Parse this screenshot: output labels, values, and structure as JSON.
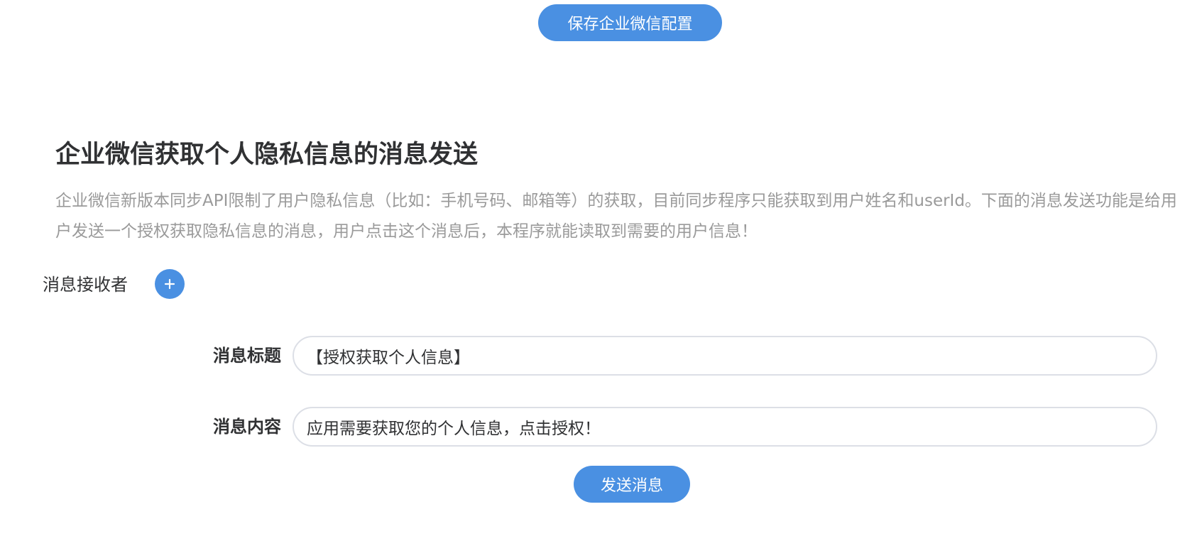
{
  "toolbar": {
    "save_label": "保存企业微信配置"
  },
  "section": {
    "title": "企业微信获取个人隐私信息的消息发送",
    "description": "企业微信新版本同步API限制了用户隐私信息（比如：手机号码、邮箱等）的获取，目前同步程序只能获取到用户姓名和userId。下面的消息发送功能是给用户发送一个授权获取隐私信息的消息，用户点击这个消息后，本程序就能读取到需要的用户信息！"
  },
  "recipients": {
    "label": "消息接收者",
    "add_icon": "plus-icon"
  },
  "form": {
    "title_label": "消息标题",
    "title_value": "【授权获取个人信息】",
    "content_label": "消息内容",
    "content_value": "应用需要获取您的个人信息，点击授权！"
  },
  "actions": {
    "send_label": "发送消息"
  },
  "colors": {
    "primary": "#4a90e2",
    "text": "#303133",
    "muted": "#9a9a9a",
    "border": "#dcdfe6"
  }
}
